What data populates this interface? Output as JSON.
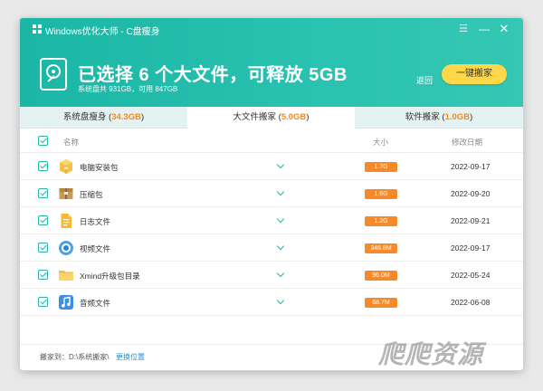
{
  "window": {
    "title": "Windows优化大师 - C盘瘦身"
  },
  "header": {
    "headline": "已选择 6 个大文件，可释放 5GB",
    "subline": "系统盘共 931GB，可用 847GB",
    "back_label": "返回",
    "move_button_label": "一键搬家"
  },
  "tabs": [
    {
      "label": "系统盘瘦身",
      "size": "34.3GB"
    },
    {
      "label": "大文件搬家",
      "size": "5.0GB"
    },
    {
      "label": "软件搬家",
      "size": "1.0GB"
    }
  ],
  "table": {
    "columns": {
      "name": "名称",
      "size": "大小",
      "date": "修改日期"
    },
    "rows": [
      {
        "name": "电脑安装包",
        "size": "1.7G",
        "date": "2022-09-17",
        "icon": "package-icon"
      },
      {
        "name": "压缩包",
        "size": "1.6G",
        "date": "2022-09-20",
        "icon": "archive-icon"
      },
      {
        "name": "日志文件",
        "size": "1.2G",
        "date": "2022-09-21",
        "icon": "document-icon"
      },
      {
        "name": "视频文件",
        "size": "346.8M",
        "date": "2022-09-17",
        "icon": "video-icon"
      },
      {
        "name": "Xmind升级包目录",
        "size": "96.0M",
        "date": "2022-05-24",
        "icon": "folder-icon"
      },
      {
        "name": "音频文件",
        "size": "68.7M",
        "date": "2022-06-08",
        "icon": "music-icon"
      }
    ]
  },
  "footer": {
    "path_label": "搬家到：D:\\系统搬家\\",
    "change_label": "更换位置"
  },
  "watermark": "爬爬资源",
  "colors": {
    "accent": "#28b6a6",
    "header": "#2ac2b0",
    "button": "#ffd84a",
    "size_badge": "#f58a2a"
  }
}
